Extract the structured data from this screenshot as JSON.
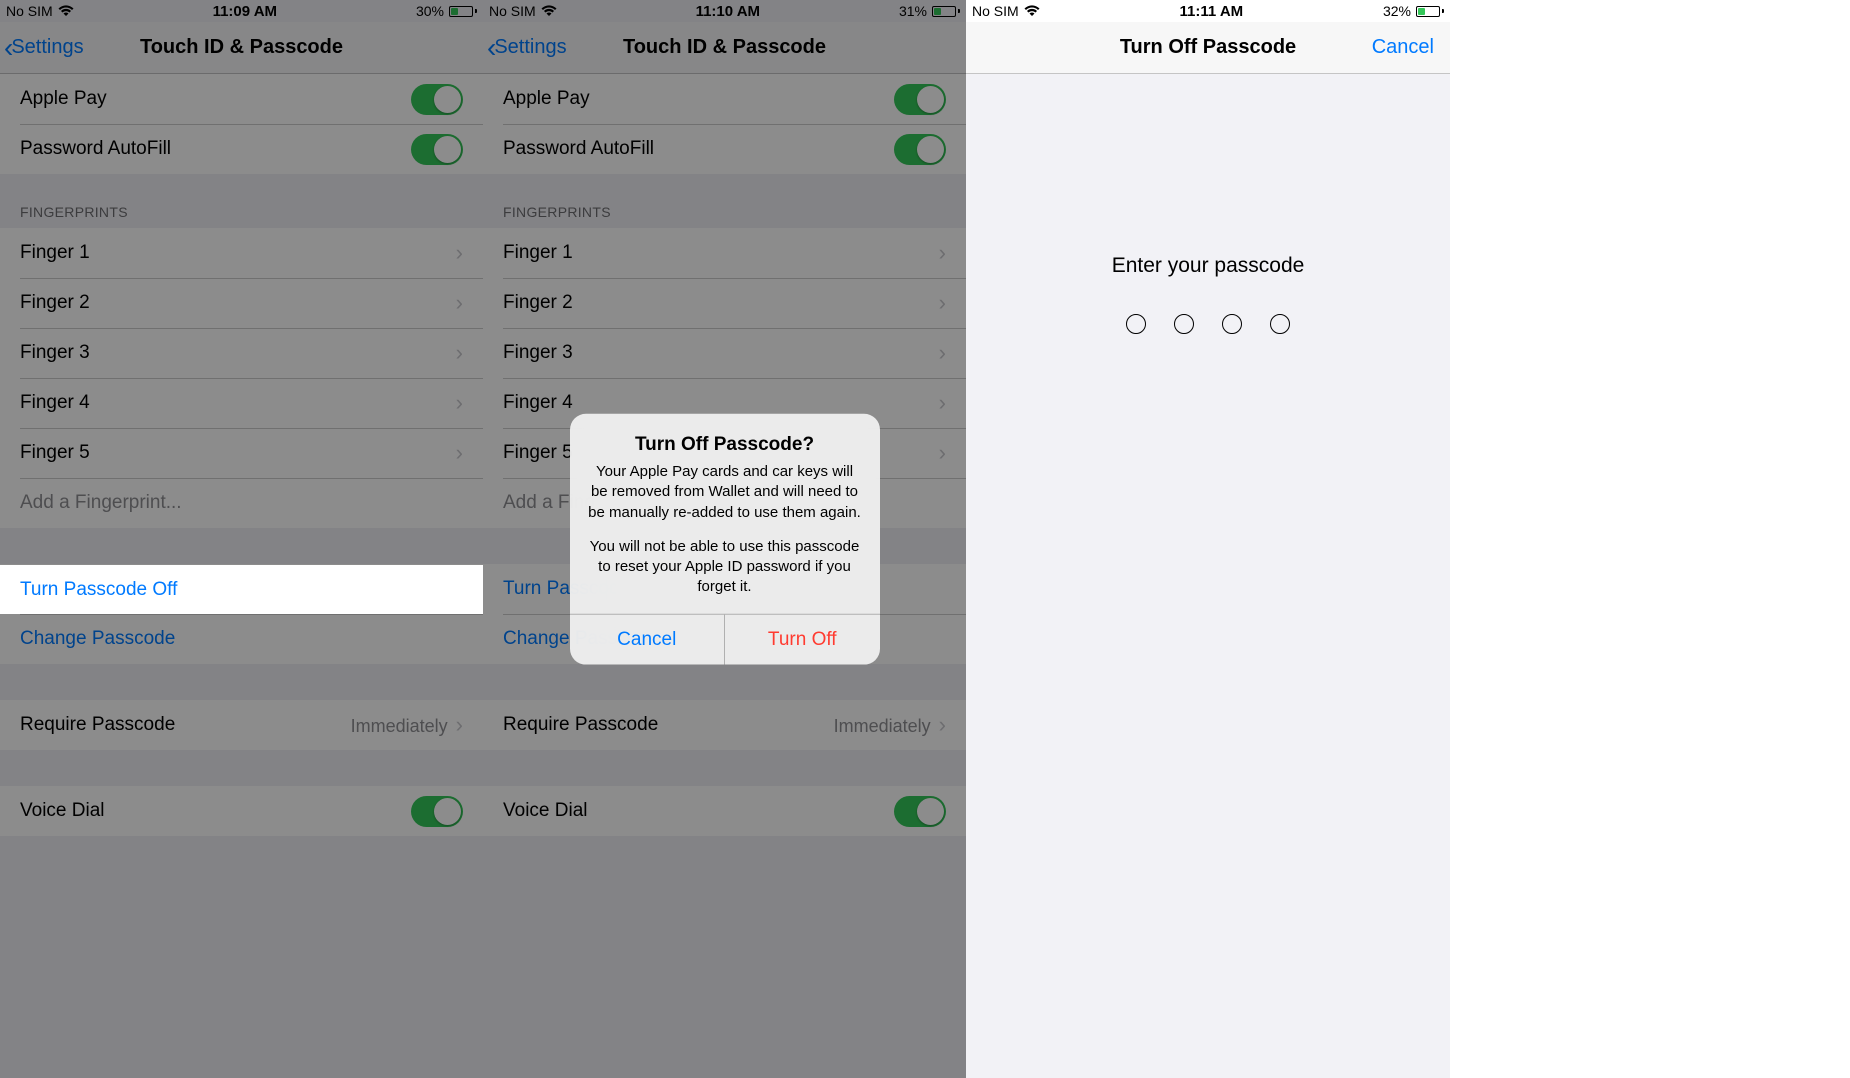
{
  "panelA": {
    "status": {
      "carrier": "No SIM",
      "time": "11:09 AM",
      "battery_pct": "30%"
    },
    "nav": {
      "back": "Settings",
      "title": "Touch ID & Passcode"
    },
    "toggles": {
      "apple_pay": "Apple Pay",
      "password_autofill": "Password AutoFill"
    },
    "fingerprints": {
      "header": "FINGERPRINTS",
      "items": [
        "Finger 1",
        "Finger 2",
        "Finger 3",
        "Finger 4",
        "Finger 5"
      ],
      "add": "Add a Fingerprint..."
    },
    "actions": {
      "turn_off": "Turn Passcode Off",
      "change": "Change Passcode"
    },
    "require": {
      "label": "Require Passcode",
      "value": "Immediately"
    },
    "voice_dial": "Voice Dial"
  },
  "panelB": {
    "status": {
      "carrier": "No SIM",
      "time": "11:10 AM",
      "battery_pct": "31%"
    },
    "nav": {
      "back": "Settings",
      "title": "Touch ID & Passcode"
    },
    "toggles": {
      "apple_pay": "Apple Pay",
      "password_autofill": "Password AutoFill"
    },
    "fingerprints": {
      "header": "FINGERPRINTS",
      "items": [
        "Finger 1",
        "Finger 2",
        "Finger 3",
        "Finger 4",
        "Finger 5"
      ],
      "add": "Add a Fingerprint..."
    },
    "actions": {
      "turn_off": "Turn Passcode Off",
      "change": "Change Passcode"
    },
    "require": {
      "label": "Require Passcode",
      "value": "Immediately"
    },
    "voice_dial": "Voice Dial",
    "alert": {
      "title": "Turn Off Passcode?",
      "msg1": "Your Apple Pay cards and car keys will be removed from Wallet and will need to be manually re-added to use them again.",
      "msg2": "You will not be able to use this passcode to reset your Apple ID password if you forget it.",
      "cancel": "Cancel",
      "confirm": "Turn Off"
    }
  },
  "panelC": {
    "status": {
      "carrier": "No SIM",
      "time": "11:11 AM",
      "battery_pct": "32%"
    },
    "nav": {
      "title": "Turn Off Passcode",
      "cancel": "Cancel"
    },
    "prompt": "Enter your passcode",
    "dot_count": 4
  }
}
